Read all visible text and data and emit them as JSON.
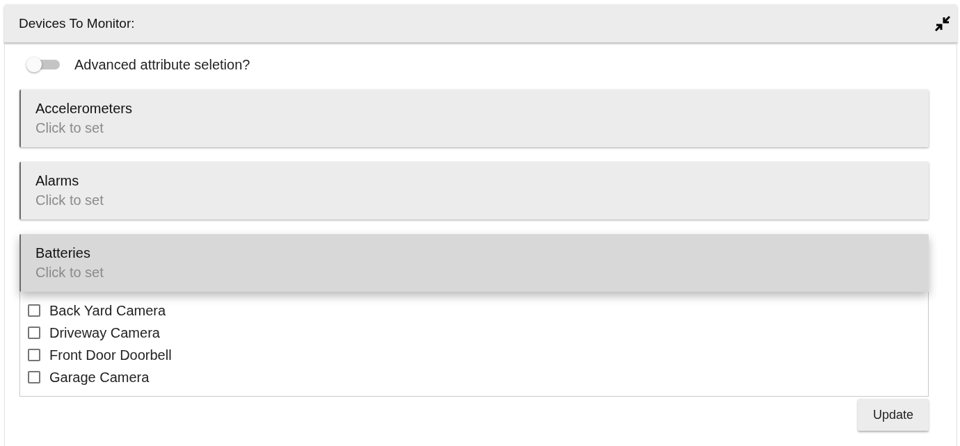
{
  "panel": {
    "title": "Devices To Monitor:"
  },
  "toggle": {
    "label": "Advanced attribute seletion?",
    "on": false
  },
  "sections": [
    {
      "title": "Accelerometers",
      "subtitle": "Click to set",
      "expanded": false
    },
    {
      "title": "Alarms",
      "subtitle": "Click to set",
      "expanded": false
    },
    {
      "title": "Batteries",
      "subtitle": "Click to set",
      "expanded": true,
      "options": [
        {
          "label": "Back Yard Camera",
          "checked": false
        },
        {
          "label": "Driveway Camera",
          "checked": false
        },
        {
          "label": "Front Door Doorbell",
          "checked": false
        },
        {
          "label": "Garage Camera",
          "checked": false
        }
      ]
    }
  ],
  "buttons": [
    {
      "label": "Update"
    }
  ]
}
